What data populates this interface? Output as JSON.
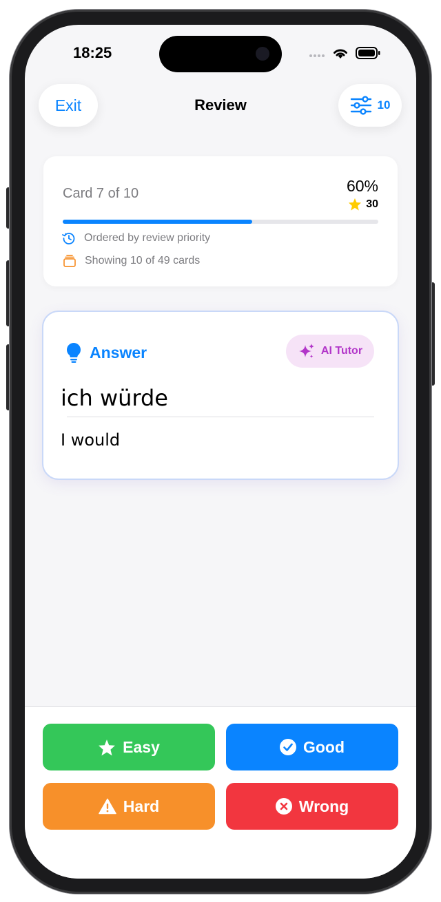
{
  "status": {
    "time": "18:25"
  },
  "header": {
    "exit_label": "Exit",
    "title": "Review",
    "settings_count": "10"
  },
  "progress": {
    "card_label": "Card 7 of 10",
    "percent_label": "60%",
    "fraction": 0.6,
    "stars": "30",
    "order_note": "Ordered by review priority",
    "showing_note": "Showing 10 of 49 cards"
  },
  "answer": {
    "heading": "Answer",
    "ai_tutor_label": "AI Tutor",
    "term": "ich würde",
    "translation": "I would"
  },
  "actions": {
    "easy": "Easy",
    "good": "Good",
    "hard": "Hard",
    "wrong": "Wrong"
  },
  "colors": {
    "accent": "#0a84ff",
    "easy": "#34c759",
    "good": "#0a84ff",
    "hard": "#f7902a",
    "wrong": "#f2363f",
    "ai_tutor": "#b235c9",
    "star": "#ffcc00"
  }
}
